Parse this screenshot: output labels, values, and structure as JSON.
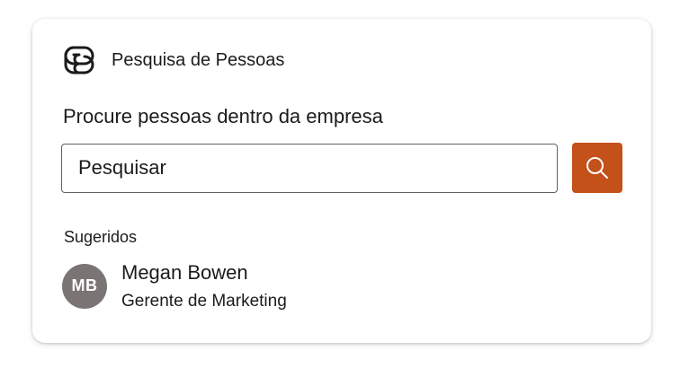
{
  "app": {
    "icon": "loop-logo-icon",
    "title": "Pesquisa de Pessoas"
  },
  "search": {
    "heading": "Procure pessoas dentro da empresa",
    "placeholder": "Pesquisar",
    "button_icon": "search-icon",
    "button_color": "#c4501a"
  },
  "suggested": {
    "label": "Sugeridos",
    "people": [
      {
        "initials": "MB",
        "name": "Megan Bowen",
        "role": "Gerente de Marketing",
        "avatar_color": "#7a7574"
      }
    ]
  }
}
